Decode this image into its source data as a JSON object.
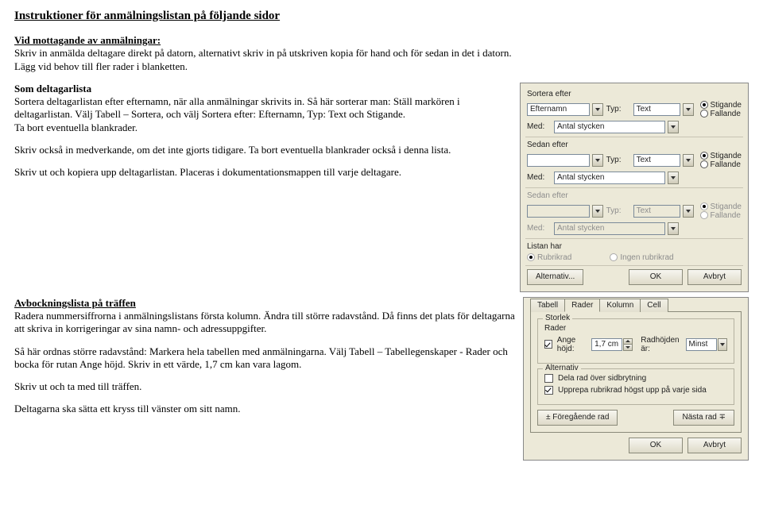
{
  "doc": {
    "title": "Instruktioner för anmälningslistan på följande sidor",
    "section1_heading": "Vid mottagande av anmälningar:",
    "section1_p1a": "Skriv in anmälda deltagare direkt på datorn, alternativt skriv in på utskriven kopia för hand och för sedan in det i datorn.",
    "section1_p1b": "Lägg vid behov till fler rader i blanketten.",
    "section2_heading": "Som deltagarlista",
    "section2_p1": "Sortera deltagarlistan efter efternamn, när alla anmälningar skrivits in. Så här sorterar man:  Ställ markören i deltagarlistan. Välj  Tabell – Sortera, och välj Sortera efter: Efternamn, Typ: Text och Stigande.",
    "section2_p2": "Ta bort eventuella blankrader.",
    "section2_p3": "Skriv också in medverkande, om det inte gjorts tidigare. Ta bort eventuella blankrader också i denna lista.",
    "section2_p4": " Skriv ut och kopiera upp deltagarlistan. Placeras i dokumentationsmappen till varje deltagare.",
    "section3_heading": "Avbockningslista på träffen",
    "section3_p1": "Radera nummersiffrorna i anmälningslistans första kolumn. Ändra till större radavstånd. Då finns det plats för deltagarna att skriva in korrigeringar av sina namn- och adressuppgifter.",
    "section3_p2": "Så här ordnas större radavstånd:  Markera hela tabellen med anmälningarna. Välj  Tabell – Tabellegenskaper - Rader  och bocka för rutan Ange höjd. Skriv in ett värde, 1,7 cm kan vara lagom.",
    "section3_p3": "Skriv ut och ta med till träffen.",
    "section3_p4": "Deltagarna ska sätta ett kryss till vänster om sitt namn."
  },
  "sort_dialog": {
    "group1": {
      "label": "Sortera efter",
      "field": "Efternamn",
      "typ_label": "Typ:",
      "typ_value": "Text",
      "radio_up": "Stigande",
      "radio_down": "Fallande",
      "med_label": "Med:",
      "med_value": "Antal stycken"
    },
    "group2": {
      "label": "Sedan efter",
      "typ_label": "Typ:",
      "typ_value": "Text",
      "radio_up": "Stigande",
      "radio_down": "Fallande",
      "med_label": "Med:",
      "med_value": "Antal stycken"
    },
    "group3": {
      "label": "Sedan efter",
      "typ_label": "Typ:",
      "typ_value": "Text",
      "radio_up": "Stigande",
      "radio_down": "Fallande",
      "med_label": "Med:",
      "med_value": "Antal stycken"
    },
    "listan_har": "Listan har",
    "rubrikrad": "Rubrikrad",
    "ingen_rubrikrad": "Ingen rubrikrad",
    "btn_alt": "Alternativ...",
    "btn_ok": "OK",
    "btn_cancel": "Avbryt"
  },
  "props_dialog": {
    "tabs": {
      "t1": "Tabell",
      "t2": "Rader",
      "t3": "Kolumn",
      "t4": "Cell"
    },
    "storlek_legend": "Storlek",
    "rader_label": "Rader",
    "ange_hojd": "Ange höjd:",
    "hojd_value": "1,7 cm",
    "radhojden_ar": "Radhöjden är:",
    "radhojden_value": "Minst",
    "alternativ_legend": "Alternativ",
    "opt1": "Dela rad över sidbrytning",
    "opt2": "Upprepa rubrikrad högst upp på varje sida",
    "btn_prev": "± Föregående rad",
    "btn_next": "Nästa rad ∓",
    "btn_ok": "OK",
    "btn_cancel": "Avbryt"
  }
}
